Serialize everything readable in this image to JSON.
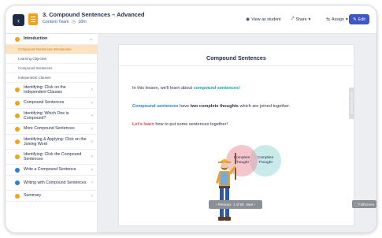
{
  "header": {
    "title": "3. Compound Sentences – Advanced",
    "team": "Content Team",
    "duration": "18m",
    "view_as_student": "View as student",
    "share": "Share",
    "assign": "Assign",
    "edit": "Edit"
  },
  "sidebar": {
    "intro": "Introduction",
    "sub": [
      "Compound Sentences Introduction",
      "Learning Objective",
      "Compound Sentences",
      "Independent Clauses"
    ],
    "items": [
      "Identifying: Click on the Independent Clauses",
      "Compound Sentences",
      "Identifying: Which One is Compound?",
      "More Compound Sentences",
      "Identifying & Applying: Click on the Joining Word",
      "Identifying: Click the Compound Sentences",
      "Write a Compound Sentence",
      "Writing with Compound Sentences",
      "Summary"
    ]
  },
  "slide": {
    "title": "Compound Sentences",
    "p1_a": "In this lesson, we'll learn about ",
    "p1_b": "compound sentences!",
    "p2_a": "Compound sentences",
    "p2_b": " have ",
    "p2_c": "two complete thoughts",
    "p2_d": " which are joined together.",
    "p3_a": "Let's learn",
    "p3_b": " how to put some sentences together!",
    "venn_left": "Complete Thought",
    "venn_right": "Complete Thought",
    "side_tab": "Hide Teacher Notes",
    "pager_prev": "Previous",
    "pager_count": "1 of 50",
    "pager_next": "Next",
    "fullscreen": "Fullscreen"
  },
  "colors": {
    "accent": "#3d57c4",
    "orange": "#f4a11b",
    "teal": "#1aa2a8",
    "red": "#e0453b",
    "blue": "#2a7de1"
  }
}
